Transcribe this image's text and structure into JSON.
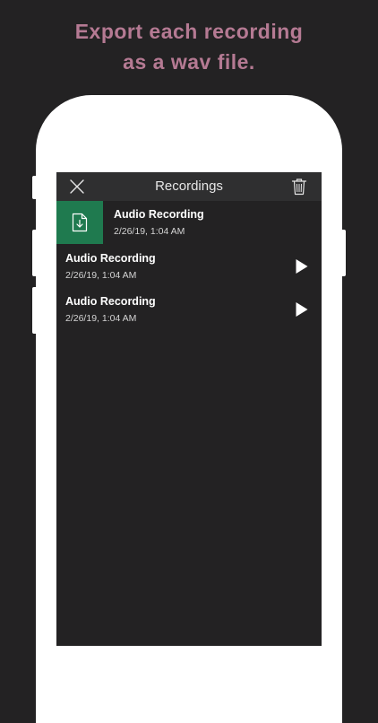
{
  "headline": {
    "line1": "Export each recording",
    "line2": "as a wav file."
  },
  "navbar": {
    "title": "Recordings",
    "left_icon": "close-icon",
    "right_icon": "trash-icon"
  },
  "recordings": [
    {
      "title": "Audio Recording",
      "date": "2/26/19, 1:04 AM",
      "action_icon": "export-file-icon",
      "swiped": true
    },
    {
      "title": "Audio Recording",
      "date": "2/26/19, 1:04 AM",
      "action_icon": "play-icon",
      "swiped": false
    },
    {
      "title": "Audio Recording",
      "date": "2/26/19, 1:04 AM",
      "action_icon": "play-icon",
      "swiped": false
    }
  ],
  "colors": {
    "background": "#232223",
    "headline": "#b57a93",
    "export_action": "#1f7a4f",
    "navbar": "#2f2f30"
  }
}
